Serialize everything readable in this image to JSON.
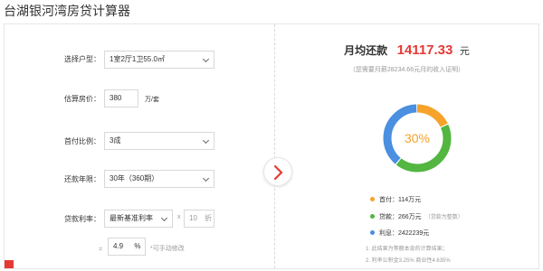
{
  "page": {
    "title": "台湖银河湾房贷计算器"
  },
  "form": {
    "house_type": {
      "label": "选择户型：",
      "value": "1室2厅1卫55.0㎡"
    },
    "price": {
      "label": "估算房价：",
      "value": "380",
      "unit": "万/套"
    },
    "down_ratio": {
      "label": "首付比例：",
      "value": "3成"
    },
    "term": {
      "label": "还款年限：",
      "value": "30年（360期）"
    },
    "rate": {
      "label": "贷款利率：",
      "value": "最新基准利率",
      "times": "x",
      "discount": "10",
      "discount_unit": "折"
    },
    "final_rate": {
      "eq": "=",
      "value": "4.9",
      "unit": "%",
      "hint": "*可手动修改"
    }
  },
  "result": {
    "monthly_label": "月均还款",
    "monthly_amount": "14117.33",
    "monthly_unit": "元",
    "income_note": "（您需要月薪28234.66元月的收入证明）",
    "ratio_text": "30%",
    "legend": [
      {
        "label": "首付：",
        "value": "114万元",
        "extra": "",
        "color": "#f5a32a"
      },
      {
        "label": "贷款：",
        "value": "266万元",
        "extra": "（贷款为整数）",
        "color": "#52b640"
      },
      {
        "label": "利息：",
        "value": "2422239元",
        "extra": "",
        "color": "#4a8fe0"
      }
    ],
    "notes": [
      "1. 此结果为等额本息的计算结果；",
      "2. 利率公积金3.25% 商业性4.635%"
    ]
  },
  "chart_data": {
    "type": "pie",
    "categories": [
      "首付",
      "贷款",
      "利息"
    ],
    "values": [
      114,
      266,
      242.2239
    ],
    "colors": [
      "#f5a32a",
      "#52b640",
      "#4a8fe0"
    ],
    "center_label": "30%"
  }
}
